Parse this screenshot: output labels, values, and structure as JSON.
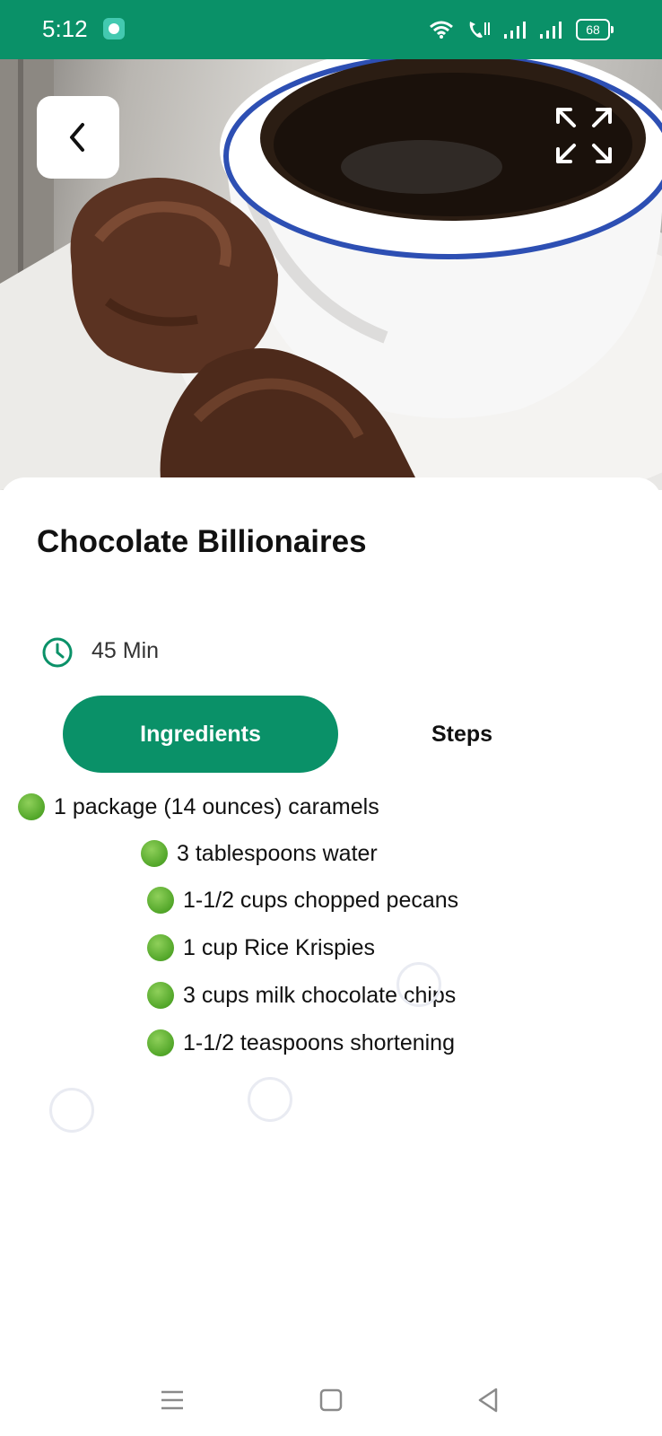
{
  "status_bar": {
    "time": "5:12",
    "battery": "68",
    "icons": [
      "wifi-icon",
      "wifi-call-icon",
      "signal-icon",
      "signal-icon",
      "battery-icon"
    ],
    "background": "#0a9168"
  },
  "hero": {
    "image": "coffee-cup-with-chocolate-clusters",
    "back_icon": "chevron-left-icon",
    "expand_icon": "fullscreen-icon"
  },
  "recipe": {
    "title": "Chocolate Billionaires",
    "duration": "45 Min",
    "duration_icon": "clock-icon"
  },
  "tabs": {
    "ingredients": "Ingredients",
    "steps": "Steps",
    "active": "ingredients",
    "accent": "#0a9168"
  },
  "ingredients": [
    "1 package (14 ounces) caramels",
    "3 tablespoons water",
    "1-1/2 cups chopped pecans",
    "1 cup Rice Krispies",
    "3 cups milk chocolate chips",
    "1-1/2 teaspoons shortening"
  ],
  "nav_bar": {
    "icons": [
      "menu-icon",
      "home-icon",
      "back-triangle-icon"
    ]
  }
}
